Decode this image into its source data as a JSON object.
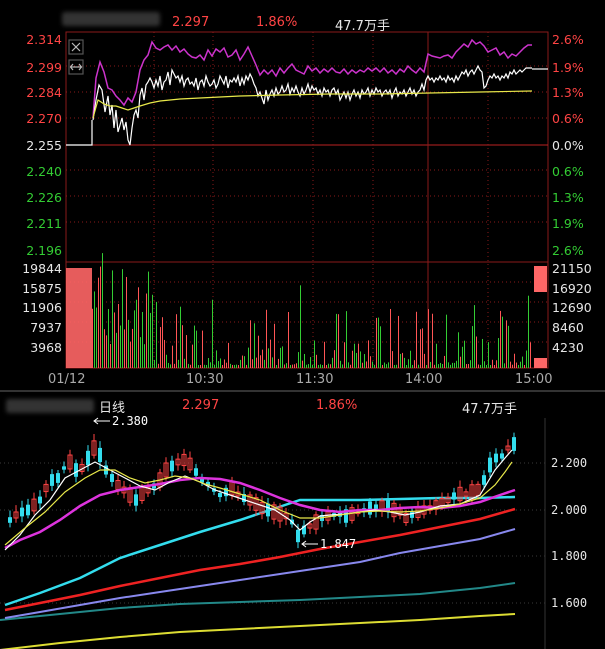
{
  "intraday": {
    "price": "2.297",
    "change_pct": "1.86%",
    "volume": "47.7万手",
    "price_labels_up": [
      "2.314",
      "2.299",
      "2.284",
      "2.270"
    ],
    "price_base": "2.255",
    "price_labels_down": [
      "2.240",
      "2.226",
      "2.211",
      "2.196"
    ],
    "pct_labels_up": [
      "2.6%",
      "1.9%",
      "1.3%",
      "0.6%"
    ],
    "pct_base": "0.0%",
    "pct_labels_down": [
      "0.6%",
      "1.3%",
      "1.9%",
      "2.6%"
    ],
    "vol_labels_left": [
      "19844",
      "15875",
      "11906",
      "7937",
      "3968"
    ],
    "vol_labels_right": [
      "21150",
      "16920",
      "12690",
      "8460",
      "4230"
    ],
    "time_labels": [
      "01/12",
      "10:30",
      "11:30",
      "14:00",
      "15:00"
    ]
  },
  "daily": {
    "period": "日线",
    "price": "2.297",
    "change_pct": "1.86%",
    "volume": "47.7万手",
    "high_marker": "2.380",
    "low_marker": "1.847",
    "axis_labels": [
      "2.200",
      "2.000",
      "1.800",
      "1.600"
    ]
  },
  "colors": {
    "up": "#ff4444",
    "down": "#33cc33",
    "price_line": "#ffffff",
    "avg_line": "#e8e84a",
    "pct_line": "#cc33cc",
    "ma_cyan": "#33ddee",
    "ma_red": "#ee2222",
    "ma_purple": "#8888ee",
    "ma_teal": "#228888",
    "ma_yellow": "#dddd33"
  }
}
